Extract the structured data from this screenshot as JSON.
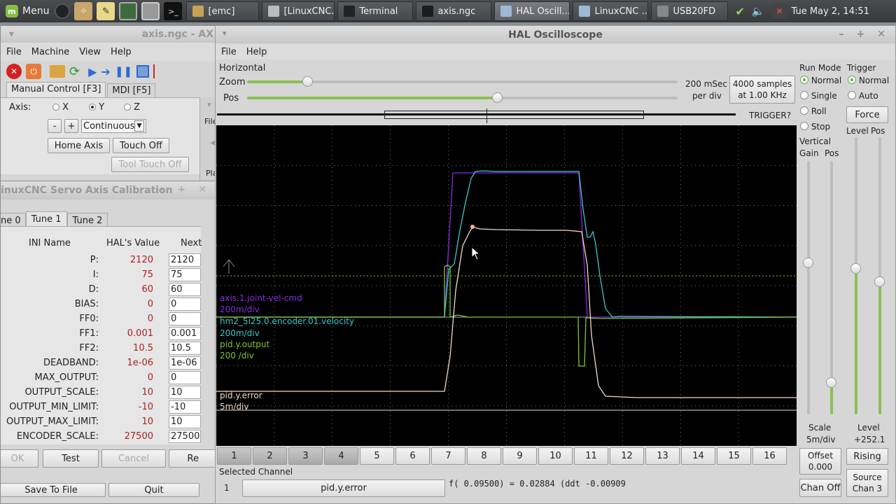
{
  "taskbar": {
    "menu_label": "Menu",
    "tasks": [
      {
        "label": "[emc]",
        "icon": "folder-icon"
      },
      {
        "label": "[LinuxCNC...",
        "icon": "document-icon"
      },
      {
        "label": "Terminal",
        "icon": "terminal-icon"
      },
      {
        "label": "axis.ngc",
        "icon": "axis-icon"
      },
      {
        "label": "HAL Oscill...",
        "icon": "window-icon",
        "active": true
      },
      {
        "label": "LinuxCNC ...",
        "icon": "window-icon"
      },
      {
        "label": "USB20FD",
        "icon": "drive-icon"
      }
    ],
    "clock": "Tue May  2, 14:51"
  },
  "axis_window": {
    "title": "axis.ngc - AX",
    "menu": [
      "File",
      "Machine",
      "View",
      "Help"
    ],
    "tabs": [
      "Manual Control [F3]",
      "MDI [F5]"
    ],
    "axis_label": "Axis:",
    "axes": [
      "X",
      "Y",
      "Z"
    ],
    "selected_axis": "Y",
    "jog_minus": "-",
    "jog_plus": "+",
    "jog_mode": "Continuous",
    "home_axis": "Home Axis",
    "touch_off": "Touch Off",
    "tool_touch_off": "Tool Touch Off",
    "side_file_label": "File",
    "side_play_label": "Pla"
  },
  "calibration": {
    "title": "inuxCNC Servo Axis Calibration",
    "tabs": [
      "ne 0",
      "Tune 1",
      "Tune 2"
    ],
    "headers": {
      "name": "INI Name",
      "hal": "HAL's Value",
      "next": "Next"
    },
    "rows": [
      {
        "name": "P:",
        "hal": "2120",
        "next": "2120"
      },
      {
        "name": "I:",
        "hal": "75",
        "next": "75"
      },
      {
        "name": "D:",
        "hal": "60",
        "next": "60"
      },
      {
        "name": "BIAS:",
        "hal": "0",
        "next": "0"
      },
      {
        "name": "FF0:",
        "hal": "0",
        "next": "0"
      },
      {
        "name": "FF1:",
        "hal": "0.001",
        "next": "0.001"
      },
      {
        "name": "FF2:",
        "hal": "10.5",
        "next": "10.5"
      },
      {
        "name": "DEADBAND:",
        "hal": "1e-06",
        "next": "1e-06"
      },
      {
        "name": "MAX_OUTPUT:",
        "hal": "0",
        "next": "0"
      },
      {
        "name": "OUTPUT_SCALE:",
        "hal": "10",
        "next": "10"
      },
      {
        "name": "OUTPUT_MIN_LIMIT:",
        "hal": "-10",
        "next": "-10"
      },
      {
        "name": "OUTPUT_MAX_LIMIT:",
        "hal": "10",
        "next": "10"
      },
      {
        "name": "ENCODER_SCALE:",
        "hal": "27500",
        "next": "27500"
      }
    ],
    "buttons": {
      "ok": "OK",
      "test": "Test",
      "cancel": "Cancel",
      "revert": "Re"
    },
    "save": "Save To File",
    "quit": "Quit"
  },
  "scope": {
    "title": "HAL Oscilloscope",
    "menu": [
      "File",
      "Help"
    ],
    "horizontal": "Horizontal",
    "zoom_label": "Zoom",
    "pos_label": "Pos",
    "zoom_level": 0.14,
    "pos_level": 0.58,
    "rate_line1": "200 mSec",
    "rate_line2": "per div",
    "samples_line1": "4000 samples",
    "samples_line2": "at 1.00 KHz",
    "trigger_status": "TRIGGER?",
    "run_mode_title": "Run Mode",
    "run_modes": [
      "Normal",
      "Single",
      "Roll",
      "Stop"
    ],
    "trigger_title": "Trigger",
    "trigger_modes": [
      "Normal",
      "Auto"
    ],
    "force": "Force",
    "vertical_title": "Vertical",
    "gain_label": "Gain",
    "vpos_label": "Pos",
    "level_label": "Level",
    "tpos_label": "Pos",
    "channels": [
      "1",
      "2",
      "3",
      "4",
      "5",
      "6",
      "7",
      "8",
      "9",
      "10",
      "11",
      "12",
      "13",
      "14",
      "15",
      "16"
    ],
    "channels_on": [
      1,
      2,
      3,
      4
    ],
    "selected_channel_label": "Selected Channel",
    "selected_channel_num": "1",
    "selected_channel_name": "pid.y.error",
    "readout": "f( 0.09500) =  0.02884 (ddt -0.00909",
    "scale_label": "Scale",
    "scale_value": "5m/div",
    "level_readout_label": "Level",
    "level_readout_value": "+252.1",
    "offset_label": "Offset",
    "offset_value": "0.000",
    "rising": "Rising",
    "chan_off": "Chan Off",
    "source_line1": "Source",
    "source_line2": "Chan 3",
    "traces": [
      {
        "name": "axis.1.joint-vel-cmd",
        "scale": "200m/div",
        "color": "#8a2be2"
      },
      {
        "name": "hm2_5i25.0.encoder.01.velocity",
        "scale": "200m/div",
        "color": "#3cc8c8"
      },
      {
        "name": "pid.y.output",
        "scale": "200 /div",
        "color": "#7ec832"
      },
      {
        "name": "pid.y.error",
        "scale": "5m/div",
        "color": "#f2d9c8"
      }
    ]
  }
}
